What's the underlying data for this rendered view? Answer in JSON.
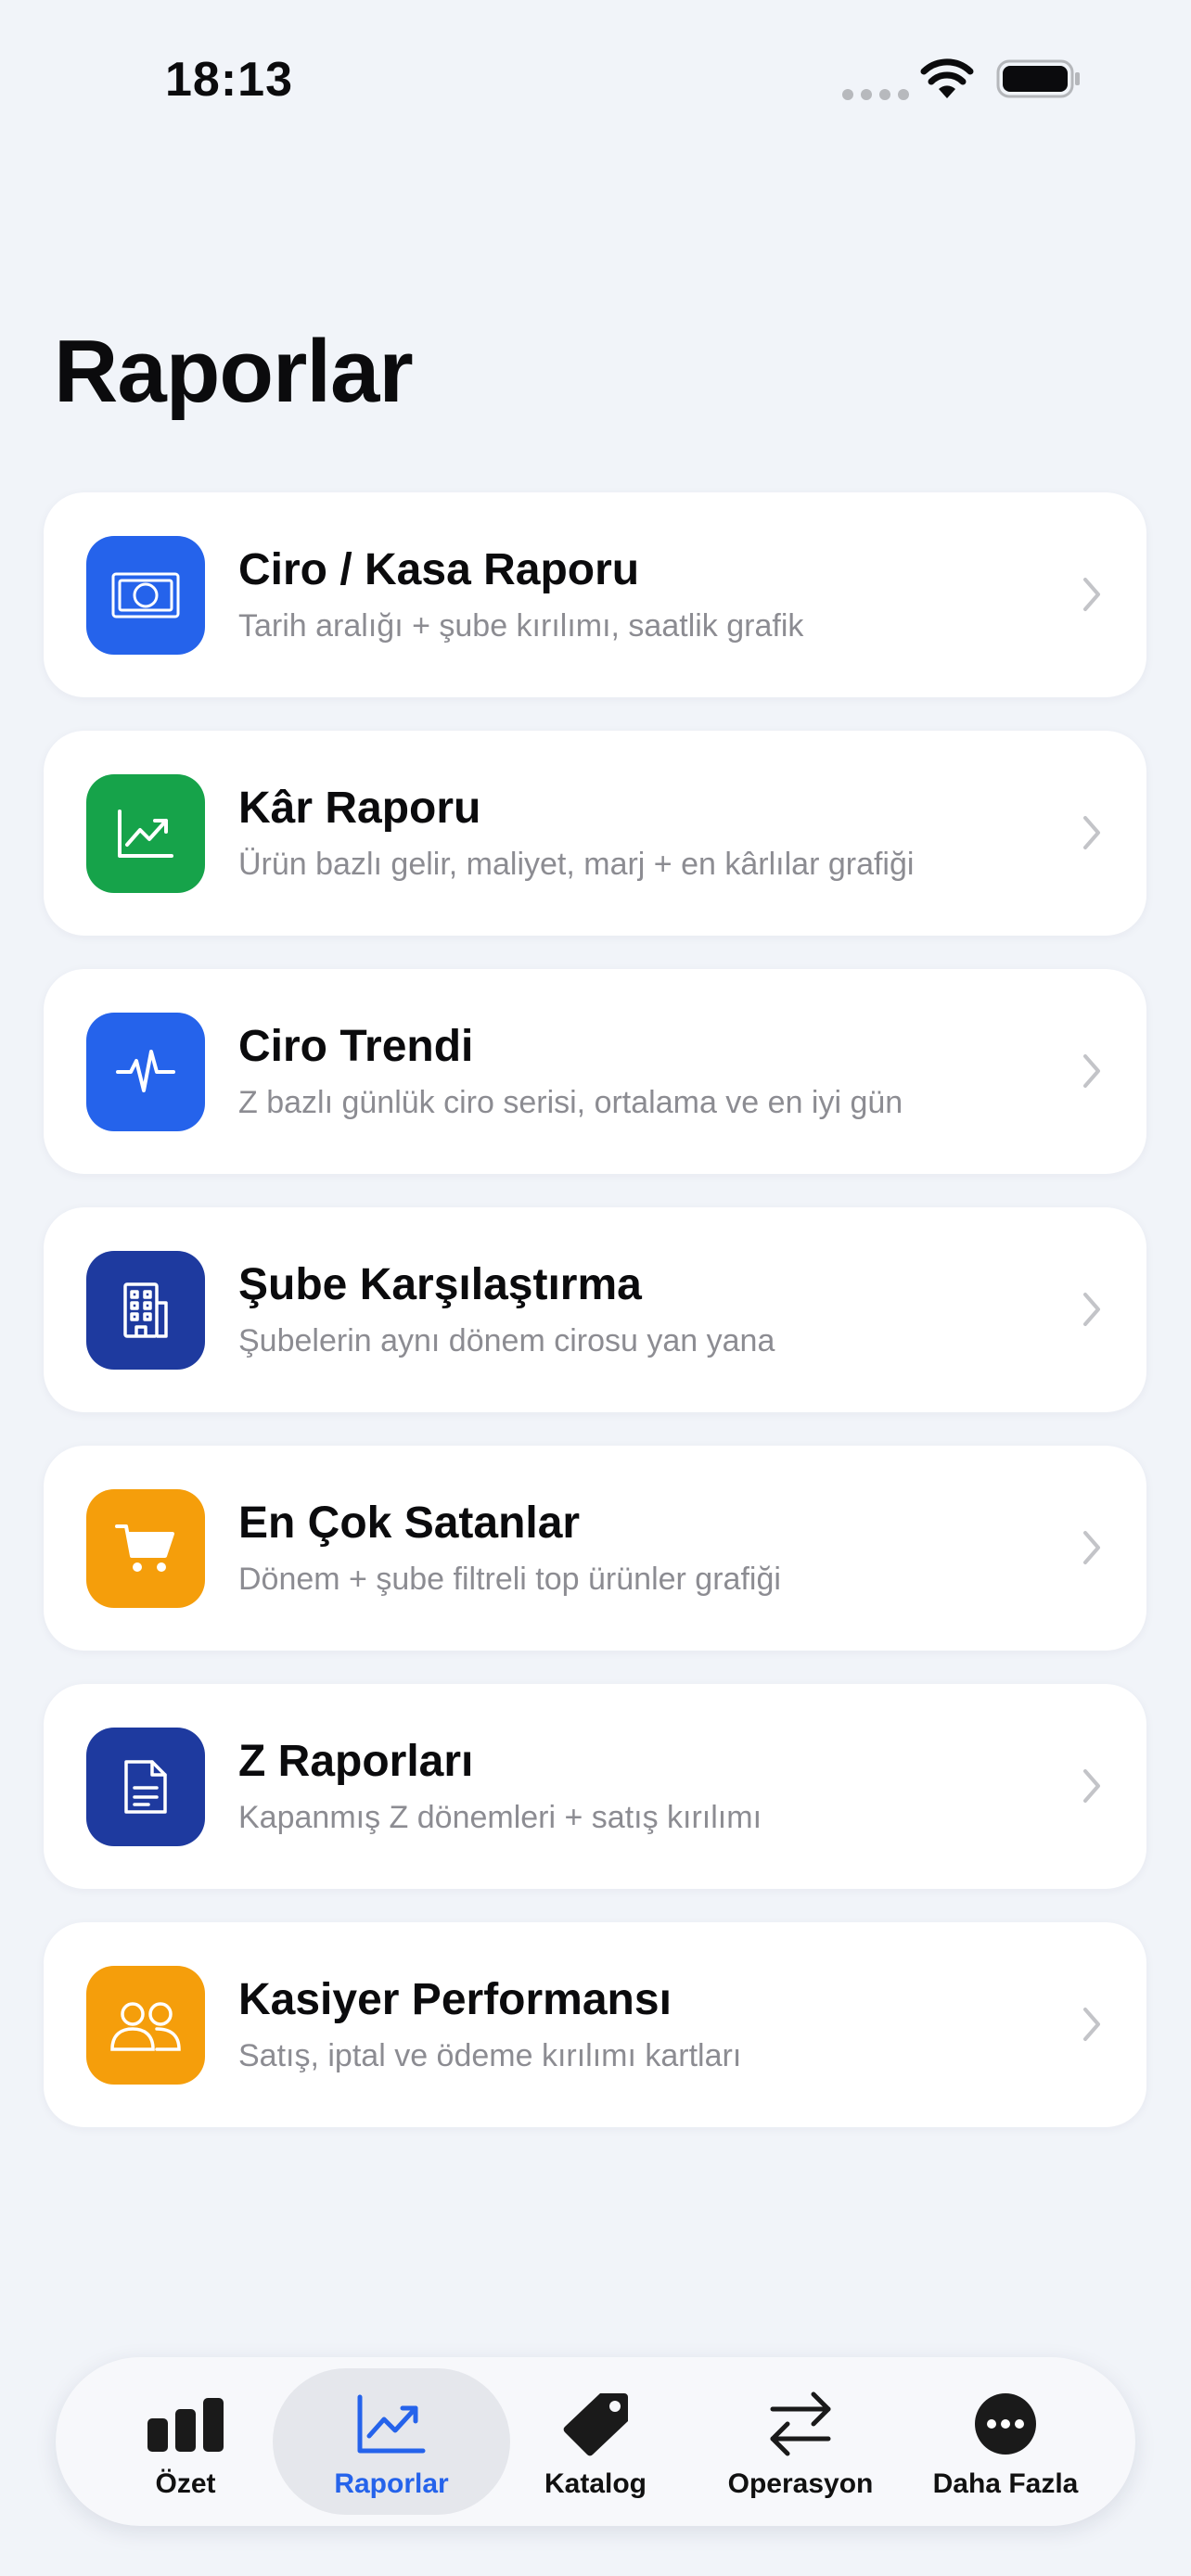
{
  "status_bar": {
    "time": "18:13"
  },
  "title": "Raporlar",
  "reports": [
    {
      "title": "Ciro / Kasa Raporu",
      "subtitle": "Tarih aralığı + şube kırılımı, saatlik grafik",
      "icon": "cash-icon",
      "color": "#2563eb"
    },
    {
      "title": "Kâr Raporu",
      "subtitle": "Ürün bazlı gelir, maliyet, marj + en kârlılar grafiği",
      "icon": "chart-line-up-icon",
      "color": "#16a34a"
    },
    {
      "title": "Ciro Trendi",
      "subtitle": "Z bazlı günlük ciro serisi, ortalama ve en iyi gün",
      "icon": "pulse-icon",
      "color": "#2563eb"
    },
    {
      "title": "Şube Karşılaştırma",
      "subtitle": "Şubelerin aynı dönem cirosu yan yana",
      "icon": "building-icon",
      "color": "#1e3a9f"
    },
    {
      "title": "En Çok Satanlar",
      "subtitle": "Dönem + şube filtreli top ürünler grafiği",
      "icon": "cart-icon",
      "color": "#f59e0b"
    },
    {
      "title": "Z Raporları",
      "subtitle": "Kapanmış Z dönemleri + satış kırılımı",
      "icon": "document-icon",
      "color": "#1e3a9f"
    },
    {
      "title": "Kasiyer Performansı",
      "subtitle": "Satış, iptal ve ödeme kırılımı kartları",
      "icon": "users-icon",
      "color": "#f59e0b"
    }
  ],
  "tabs": [
    {
      "label": "Özet",
      "icon": "bar-chart-icon",
      "active": false
    },
    {
      "label": "Raporlar",
      "icon": "chart-line-up-icon",
      "active": true
    },
    {
      "label": "Katalog",
      "icon": "tag-icon",
      "active": false
    },
    {
      "label": "Operasyon",
      "icon": "arrows-swap-icon",
      "active": false
    },
    {
      "label": "Daha Fazla",
      "icon": "more-icon",
      "active": false
    }
  ],
  "colors": {
    "accent": "#2563eb",
    "background": "#f1f4f9"
  }
}
